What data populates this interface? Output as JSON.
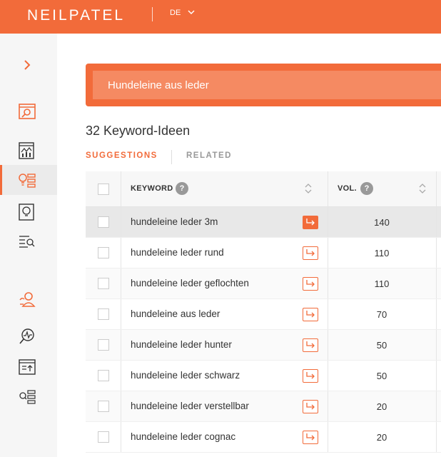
{
  "header": {
    "logo": "NEILPATEL",
    "language": "DE",
    "brand_color": "#f26b3a"
  },
  "sidebar": {
    "toggle_icon": "chevron-right-icon",
    "items": [
      {
        "icon": "seo-analyzer-icon",
        "active": false
      },
      {
        "icon": "traffic-chart-icon",
        "active": false
      },
      {
        "icon": "keyword-ideas-icon",
        "active": true
      },
      {
        "icon": "content-ideas-icon",
        "active": false
      },
      {
        "icon": "backlinks-icon",
        "active": false
      },
      {
        "icon": "users-icon",
        "active": false
      },
      {
        "icon": "site-audit-icon",
        "active": false
      },
      {
        "icon": "rank-tracker-icon",
        "active": false
      },
      {
        "icon": "list-search-icon",
        "active": false
      }
    ]
  },
  "search": {
    "value": "Hundeleine aus leder"
  },
  "results": {
    "count_label": "32 Keyword-Ideen"
  },
  "tabs": [
    {
      "label": "SUGGESTIONS",
      "active": true
    },
    {
      "label": "RELATED",
      "active": false
    }
  ],
  "table": {
    "columns": {
      "keyword": "KEYWORD",
      "volume": "VOL.",
      "help_mark": "?"
    },
    "rows": [
      {
        "keyword": "hundeleine leder 3m",
        "volume": "140"
      },
      {
        "keyword": "hundeleine leder rund",
        "volume": "110"
      },
      {
        "keyword": "hundeleine leder geflochten",
        "volume": "110"
      },
      {
        "keyword": "hundeleine aus leder",
        "volume": "70"
      },
      {
        "keyword": "hundeleine leder hunter",
        "volume": "50"
      },
      {
        "keyword": "hundeleine leder schwarz",
        "volume": "50"
      },
      {
        "keyword": "hundeleine leder verstellbar",
        "volume": "20"
      },
      {
        "keyword": "hundeleine leder cognac",
        "volume": "20"
      }
    ]
  }
}
